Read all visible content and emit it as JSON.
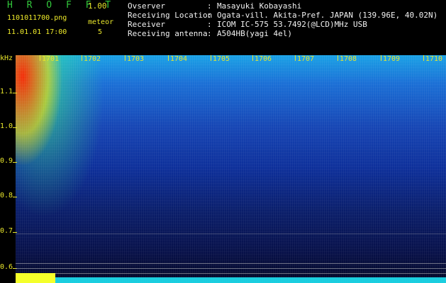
{
  "header": {
    "brand": "H R O F F T",
    "version": "1.00",
    "filename": "1101011700.png",
    "datetime": "11.01.01 17:00",
    "meteor_label": "meteor",
    "meteor_count": "5",
    "info": [
      {
        "label": "Ovserver",
        "value": "Masayuki Kobayashi"
      },
      {
        "label": "Receiving Location",
        "value": "Ogata-vill. Akita-Pref. JAPAN (139.96E, 40.02N)"
      },
      {
        "label": "Receiver",
        "value": "ICOM IC-575 53.7492(@LCD)MHz USB"
      },
      {
        "label": "Receiving antenna",
        "value": "A504HB(yagi 4el)"
      }
    ],
    "colon": ":"
  },
  "axes": {
    "y_unit": "kHz",
    "y_ticks": [
      "1.1",
      "1.0",
      "0.9",
      "0.8",
      "0.7",
      "0.6"
    ],
    "x_ticks": [
      "1701",
      "1702",
      "1703",
      "1704",
      "1705",
      "1706",
      "1707",
      "1708",
      "1709",
      "1710"
    ]
  },
  "colors": {
    "yellow": "#e9e62b",
    "green": "#32c83c"
  }
}
